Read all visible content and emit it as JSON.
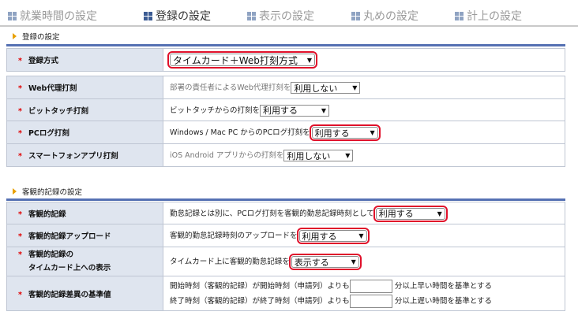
{
  "tabs": [
    {
      "label": "就業時間の設定",
      "active": false
    },
    {
      "label": "登録の設定",
      "active": true
    },
    {
      "label": "表示の設定",
      "active": false
    },
    {
      "label": "丸めの設定",
      "active": false
    },
    {
      "label": "計上の設定",
      "active": false
    }
  ],
  "section1": {
    "title": "登録の設定",
    "rows": [
      {
        "label": "登録方式",
        "text": "",
        "select": "タイムカード＋Web打刻方式"
      },
      {
        "label": "Web代理打刻",
        "text": "部署の責任者によるWeb代理打刻を",
        "select": "利用しない"
      },
      {
        "label": "ビットタッチ打刻",
        "text": "ビットタッチからの打刻を",
        "select": "利用する"
      },
      {
        "label": "PCログ打刻",
        "text": "Windows / Mac PC からのPCログ打刻を",
        "select": "利用する"
      },
      {
        "label": "スマートフォンアプリ打刻",
        "text": "iOS Android アプリからの打刻を",
        "select": "利用しない"
      }
    ]
  },
  "section2": {
    "title": "客観的記録の設定",
    "rows": [
      {
        "label": "客観的記録",
        "text": "勤怠記録とは別に、PCログ打刻を客観的勤怠記録時刻として",
        "select": "利用する"
      },
      {
        "label": "客観的記録アップロード",
        "text": "客観的勤怠記録時刻のアップロードを",
        "select": "利用する"
      },
      {
        "label_line1": "客観的記録の",
        "label_line2": "タイムカード上への表示",
        "text": "タイムカード上に客観的勤怠記録を",
        "select": "表示する"
      },
      {
        "label": "客観的記録差異の基準値",
        "line1_prefix": "開始時刻（客観的記録）が開始時刻（申請列）よりも",
        "line1_suffix": "分以上早い時間を基準とする",
        "line1_value": "",
        "line2_prefix": "終了時刻（客観的記録）が終了時刻（申請列）よりも",
        "line2_suffix": "分以上遅い時間を基準とする",
        "line2_value": ""
      }
    ]
  },
  "required_mark": "*",
  "colors": {
    "accent": "#5571b3",
    "highlight": "#e0102a",
    "label_bg": "#dfe5ef",
    "section_marker": "#e8a000"
  }
}
